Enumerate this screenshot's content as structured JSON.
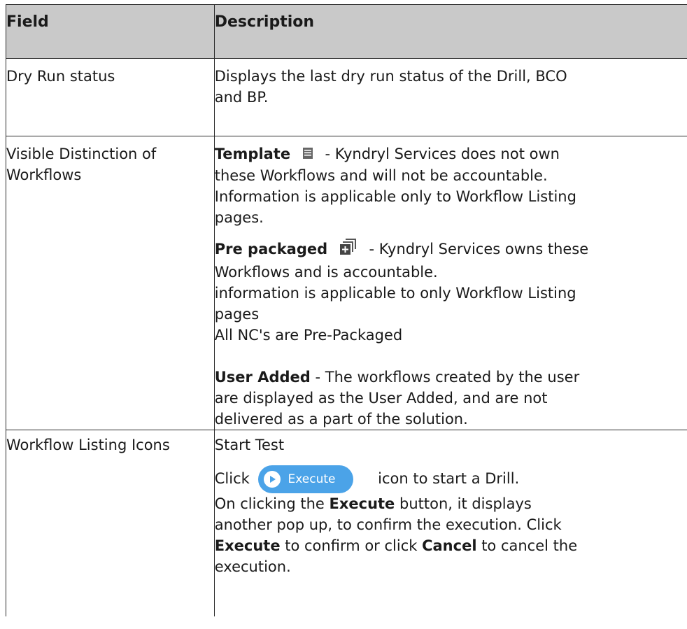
{
  "table": {
    "headers": {
      "field": "Field",
      "description": "Description"
    },
    "rows": {
      "dry_run": {
        "field": "Dry Run status",
        "line1": "Displays the last dry run status of the Drill, BCO",
        "line2": "and BP."
      },
      "visible": {
        "field_line1": "Visible Distinction of",
        "field_line2": "Workflows",
        "template_label": "Template",
        "template_line1": " - Kyndryl Services does not own",
        "template_line2": "these Workflows  and will not be accountable.",
        "template_line3": "Information is applicable only to Workflow Listing",
        "template_line4": "pages.",
        "prepack_label": "Pre packaged",
        "prepack_line1": " - Kyndryl Services owns these",
        "prepack_line2": "Workflows and is accountable.",
        "prepack_line3": "information is applicable to only Workflow Listing",
        "prepack_line4": "pages",
        "prepack_line5": "All NC's are Pre-Packaged",
        "user_label": "User Added",
        "user_line1": " - The workflows created by the user",
        "user_line2": "are displayed as the User Added, and are not",
        "user_line3": "delivered as a part of the solution."
      },
      "icons": {
        "field": "Workflow Listing Icons",
        "start_test": "Start Test",
        "click": "Click",
        "execute_button": "Execute",
        "click_tail": "icon to start a Drill.",
        "line2_pre": "On clicking  the ",
        "line2_bold": "Execute",
        "line2_post": " button, it displays",
        "line3": "another pop up, to confirm the execution. Click",
        "line4_bold1": "Execute",
        "line4_mid": " to confirm or click ",
        "line4_bold2": "Cancel",
        "line4_post": " to cancel the",
        "line5": "execution."
      }
    }
  },
  "colors": {
    "header_bg": "#c9c9c9",
    "accent": "#e8491d",
    "button": "#4ba3e8"
  },
  "icons": [
    "template-icon",
    "prepackaged-icon",
    "play-icon"
  ]
}
